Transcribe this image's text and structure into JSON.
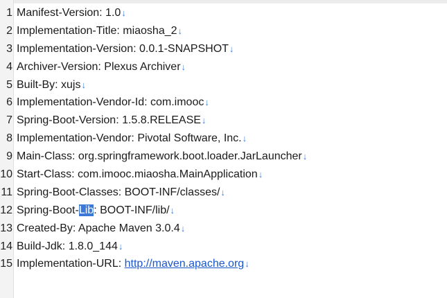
{
  "editor": {
    "eol_marker": "↓",
    "lines": [
      {
        "number": "1",
        "text": "Manifest-Version: 1.0"
      },
      {
        "number": "2",
        "text": "Implementation-Title: miaosha_2"
      },
      {
        "number": "3",
        "text": "Implementation-Version: 0.0.1-SNAPSHOT"
      },
      {
        "number": "4",
        "text": "Archiver-Version: Plexus Archiver"
      },
      {
        "number": "5",
        "text": "Built-By: xujs"
      },
      {
        "number": "6",
        "text": "Implementation-Vendor-Id: com.imooc"
      },
      {
        "number": "7",
        "text": "Spring-Boot-Version: 1.5.8.RELEASE"
      },
      {
        "number": "8",
        "text": "Implementation-Vendor: Pivotal Software, Inc."
      },
      {
        "number": "9",
        "text": "Main-Class: org.springframework.boot.loader.JarLauncher"
      },
      {
        "number": "10",
        "text": "Start-Class: com.imooc.miaosha.MainApplication"
      },
      {
        "number": "11",
        "text": "Spring-Boot-Classes: BOOT-INF/classes/"
      },
      {
        "number": "12",
        "text_before": "Spring-Boot-",
        "text_selected": "Lib",
        "text_after": ": BOOT-INF/lib/"
      },
      {
        "number": "13",
        "text": "Created-By: Apache Maven 3.0.4"
      },
      {
        "number": "14",
        "text": "Build-Jdk: 1.8.0_144"
      },
      {
        "number": "15",
        "text_before": "Implementation-URL: ",
        "link": "http://maven.apache.org"
      }
    ]
  },
  "colors": {
    "selection": "#3c78d8",
    "eol_marker": "#3f7fd9",
    "link": "#1a56c9"
  }
}
